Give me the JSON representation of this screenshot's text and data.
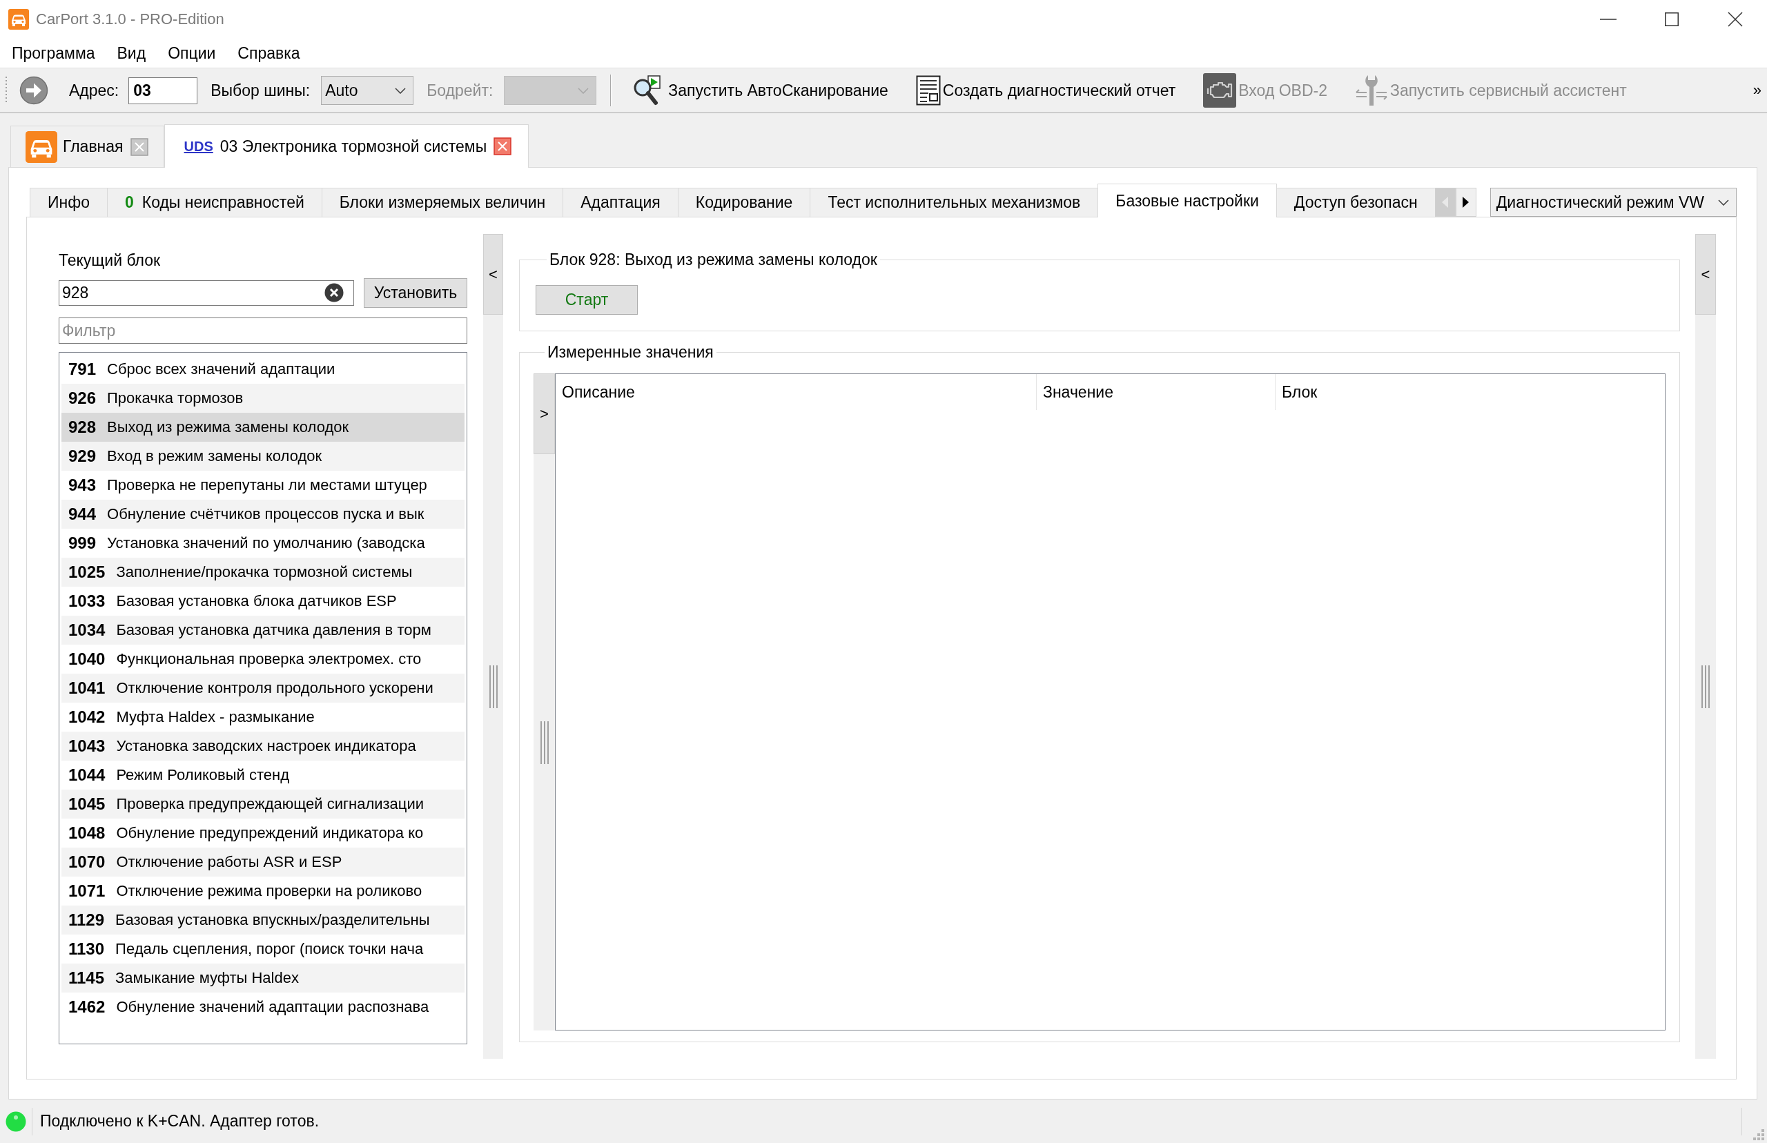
{
  "window": {
    "title": "CarPort 3.1.0 - PRO-Edition"
  },
  "menu": [
    "Программа",
    "Вид",
    "Опции",
    "Справка"
  ],
  "toolbar": {
    "address": {
      "label": "Адрес:",
      "value": "03"
    },
    "bus": {
      "label": "Выбор шины:",
      "value": "Auto"
    },
    "baudrate": {
      "label": "Бодрейт:",
      "disabled": true
    },
    "actions": [
      {
        "kind": "autoscan",
        "label": "Запустить АвтоСканирование",
        "disabled": false
      },
      {
        "kind": "report",
        "label": "Создать диагностический отчет",
        "disabled": false
      },
      {
        "kind": "obd",
        "label": "Вход OBD-2",
        "disabled": true
      },
      {
        "kind": "service",
        "label": "Запустить сервисный ассистент",
        "disabled": true
      }
    ],
    "overflow": "»"
  },
  "document_tabs": [
    {
      "kind": "home",
      "label": "Главная",
      "selected": false
    },
    {
      "kind": "module",
      "protocol": "UDS",
      "label": "03 Электроника тормозной системы",
      "selected": true
    }
  ],
  "function_tabs": [
    {
      "label": "Инфо",
      "selected": false
    },
    {
      "count": "0",
      "label": "Коды неисправностей",
      "selected": false
    },
    {
      "label": "Блоки измеряемых величин",
      "selected": false
    },
    {
      "label": "Адаптация",
      "selected": false
    },
    {
      "label": "Кодирование",
      "selected": false
    },
    {
      "label": "Тест исполнительных механизмов",
      "selected": false
    },
    {
      "label": "Базовые настройки",
      "selected": true
    },
    {
      "label": "Доступ безопасн",
      "selected": false
    }
  ],
  "tab_scroll": {
    "back": {
      "disabled": true
    },
    "forward": {
      "disabled": false
    }
  },
  "mode_dropdown": {
    "value": "Диагностический режим VW"
  },
  "current_block": {
    "label": "Текущий блок",
    "value": "928",
    "button": "Установить"
  },
  "filter": {
    "placeholder": "Фильтр"
  },
  "block_list": [
    {
      "number": "791",
      "label": "Сброс всех значений адаптации",
      "selected": false
    },
    {
      "number": "926",
      "label": "Прокачка тормозов",
      "selected": false
    },
    {
      "number": "928",
      "label": "Выход из режима замены колодок",
      "selected": true
    },
    {
      "number": "929",
      "label": "Вход в режим замены колодок",
      "selected": false
    },
    {
      "number": "943",
      "label": "Проверка не перепутаны ли местами штуцер",
      "selected": false
    },
    {
      "number": "944",
      "label": "Обнуление счётчиков процессов пуска и вык",
      "selected": false
    },
    {
      "number": "999",
      "label": "Установка значений по умолчанию (заводска",
      "selected": false
    },
    {
      "number": "1025",
      "label": "Заполнение/прокачка тормозной системы",
      "selected": false
    },
    {
      "number": "1033",
      "label": "Базовая установка блока датчиков ESP",
      "selected": false
    },
    {
      "number": "1034",
      "label": "Базовая установка датчика давления в торм",
      "selected": false
    },
    {
      "number": "1040",
      "label": "Функциональная проверка электромех. сто",
      "selected": false
    },
    {
      "number": "1041",
      "label": "Отключение контроля продольного ускорени",
      "selected": false
    },
    {
      "number": "1042",
      "label": "Муфта Haldex - размыкание",
      "selected": false
    },
    {
      "number": "1043",
      "label": "Установка заводских настроек индикатора",
      "selected": false
    },
    {
      "number": "1044",
      "label": "Режим Роликовый стенд",
      "selected": false
    },
    {
      "number": "1045",
      "label": "Проверка предупреждающей сигнализации",
      "selected": false
    },
    {
      "number": "1048",
      "label": "Обнуление предупреждений индикатора ко",
      "selected": false
    },
    {
      "number": "1070",
      "label": "Отключение работы ASR и ESP",
      "selected": false
    },
    {
      "number": "1071",
      "label": "Отключение режима проверки на роликово",
      "selected": false
    },
    {
      "number": "1129",
      "label": "Базовая установка впускных/разделительны",
      "selected": false
    },
    {
      "number": "1130",
      "label": "Педаль сцепления, порог (поиск точки нача",
      "selected": false
    },
    {
      "number": "1145",
      "label": "Замыкание муфты Haldex",
      "selected": false
    },
    {
      "number": "1462",
      "label": "Обнуление значений адаптации распознава",
      "selected": false
    }
  ],
  "left_toggle": "<",
  "block_group": {
    "title": "Блок 928: Выход из режима замены колодок",
    "button": "Старт"
  },
  "measured_group": {
    "title": "Измеренные значения",
    "toggle": ">",
    "columns": [
      "Описание",
      "Значение",
      "Блок"
    ]
  },
  "right_toggle": "<",
  "status_bar": {
    "connected": true,
    "text": "Подключено к K+CAN. Адаптер готов."
  }
}
